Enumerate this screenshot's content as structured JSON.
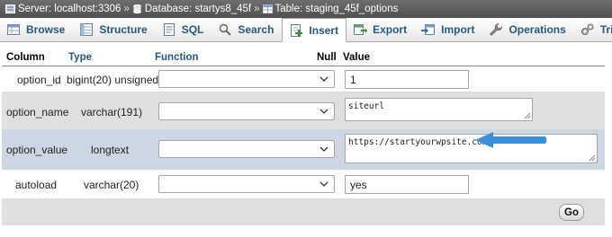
{
  "breadcrumb": {
    "server": "Server: localhost:3306",
    "database": "Database: startys8_45f",
    "table": "Table: staging_45f_options",
    "separator": "»"
  },
  "tabs": [
    {
      "label": "Browse",
      "icon": "browse-icon",
      "active": false
    },
    {
      "label": "Structure",
      "icon": "structure-icon",
      "active": false
    },
    {
      "label": "SQL",
      "icon": "sql-icon",
      "active": false
    },
    {
      "label": "Search",
      "icon": "search-icon",
      "active": false
    },
    {
      "label": "Insert",
      "icon": "insert-icon",
      "active": true
    },
    {
      "label": "Export",
      "icon": "export-icon",
      "active": false
    },
    {
      "label": "Import",
      "icon": "import-icon",
      "active": false
    },
    {
      "label": "Operations",
      "icon": "wrench-icon",
      "active": false
    },
    {
      "label": "Triggers",
      "icon": "triggers-icon",
      "active": false
    }
  ],
  "columns": {
    "column": "Column",
    "type": "Type",
    "function": "Function",
    "null": "Null",
    "value": "Value"
  },
  "rows": [
    {
      "column": "option_id",
      "type": "bigint(20) unsigned",
      "function": "",
      "value": "1"
    },
    {
      "column": "option_name",
      "type": "varchar(191)",
      "function": "",
      "value": "siteurl"
    },
    {
      "column": "option_value",
      "type": "longtext",
      "function": "",
      "value": "https://startyourwpsite.com/"
    },
    {
      "column": "autoload",
      "type": "varchar(20)",
      "function": "",
      "value": "yes"
    }
  ],
  "go_button": "Go",
  "colors": {
    "accent_arrow": "#3d8fd8",
    "tab_text": "#235a81",
    "highlight_row": "#ccd7e3"
  }
}
